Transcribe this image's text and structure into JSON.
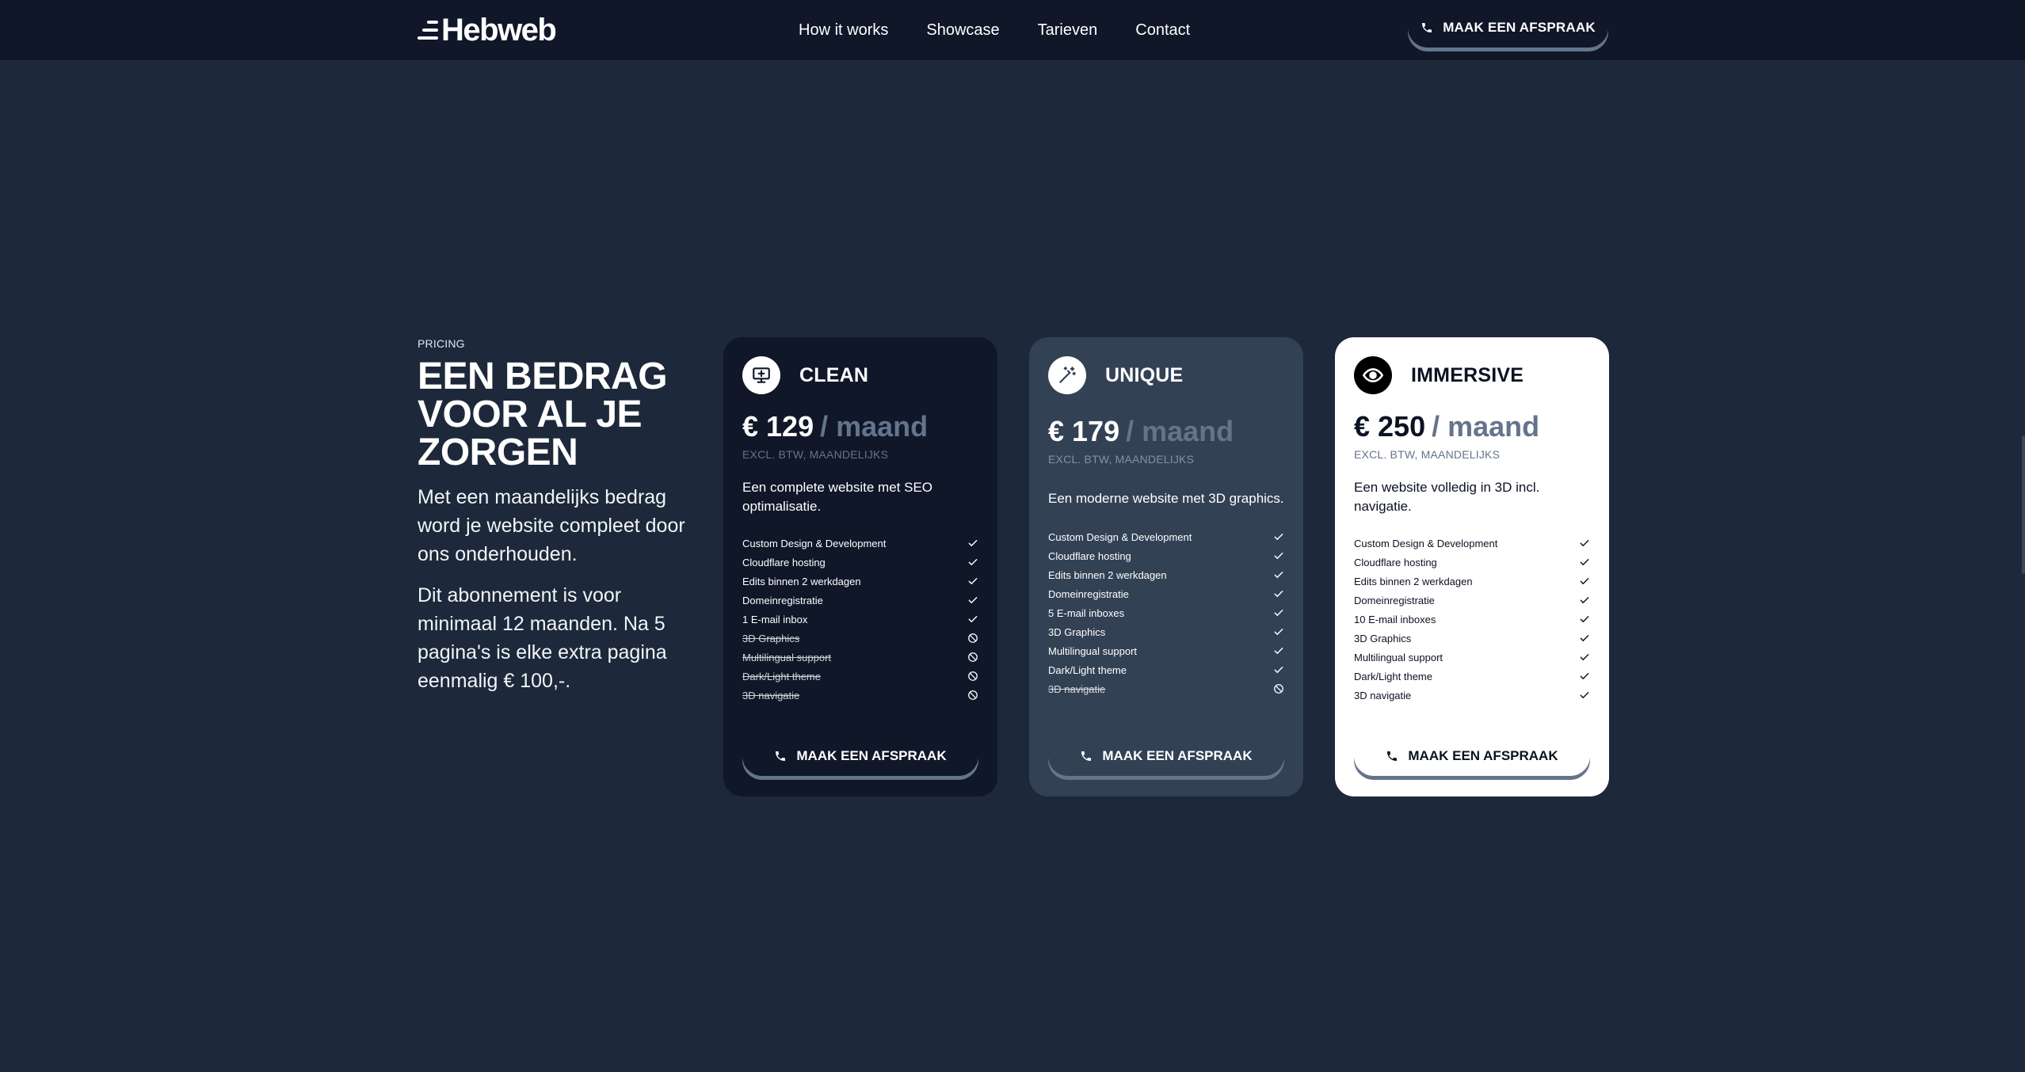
{
  "brand": {
    "name": "Hebweb"
  },
  "nav": {
    "links": [
      "How it works",
      "Showcase",
      "Tarieven",
      "Contact"
    ],
    "cta_label": "MAAK EEN AFSPRAAK"
  },
  "intro": {
    "eyebrow": "PRICING",
    "headline": "EEN BEDRAG VOOR AL JE ZORGEN",
    "paragraphs": [
      "Met een maandelijks bedrag word je website compleet door ons onderhouden.",
      "Dit abonnement is voor minimaal 12 maanden. Na 5 pagina's is elke extra pagina eenmalig € 100,-."
    ]
  },
  "plans": [
    {
      "name": "CLEAN",
      "icon": "monitor-icon",
      "price": "€ 129",
      "period": "/ maand",
      "note": "EXCL. BTW, MAANDELIJKS",
      "description": "Een complete website met SEO optimalisatie.",
      "features": [
        {
          "label": "Custom Design & Development",
          "included": true
        },
        {
          "label": "Cloudflare hosting",
          "included": true
        },
        {
          "label": "Edits binnen 2 werkdagen",
          "included": true
        },
        {
          "label": "Domeinregistratie",
          "included": true
        },
        {
          "label": "1 E-mail inbox",
          "included": true
        },
        {
          "label": "3D Graphics",
          "included": false
        },
        {
          "label": "Multilingual support",
          "included": false
        },
        {
          "label": "Dark/Light theme",
          "included": false
        },
        {
          "label": "3D navigatie",
          "included": false
        }
      ],
      "cta_label": "MAAK EEN AFSPRAAK"
    },
    {
      "name": "UNIQUE",
      "icon": "magic-wand-icon",
      "price": "€ 179",
      "period": "/ maand",
      "note": "EXCL. BTW, MAANDELIJKS",
      "description": "Een moderne website met 3D graphics.",
      "features": [
        {
          "label": "Custom Design & Development",
          "included": true
        },
        {
          "label": "Cloudflare hosting",
          "included": true
        },
        {
          "label": "Edits binnen 2 werkdagen",
          "included": true
        },
        {
          "label": "Domeinregistratie",
          "included": true
        },
        {
          "label": "5 E-mail inboxes",
          "included": true
        },
        {
          "label": "3D Graphics",
          "included": true
        },
        {
          "label": "Multilingual support",
          "included": true
        },
        {
          "label": "Dark/Light theme",
          "included": true
        },
        {
          "label": "3D navigatie",
          "included": false
        }
      ],
      "cta_label": "MAAK EEN AFSPRAAK"
    },
    {
      "name": "IMMERSIVE",
      "icon": "eye-icon",
      "price": "€ 250",
      "period": "/ maand",
      "note": "EXCL. BTW, MAANDELIJKS",
      "description": "Een website volledig in 3D incl. navigatie.",
      "features": [
        {
          "label": "Custom Design & Development",
          "included": true
        },
        {
          "label": "Cloudflare hosting",
          "included": true
        },
        {
          "label": "Edits binnen 2 werkdagen",
          "included": true
        },
        {
          "label": "Domeinregistratie",
          "included": true
        },
        {
          "label": "10 E-mail inboxes",
          "included": true
        },
        {
          "label": "3D Graphics",
          "included": true
        },
        {
          "label": "Multilingual support",
          "included": true
        },
        {
          "label": "Dark/Light theme",
          "included": true
        },
        {
          "label": "3D navigatie",
          "included": true
        }
      ],
      "cta_label": "MAAK EEN AFSPRAAK"
    }
  ],
  "colors": {
    "page_bg": "#1d283a",
    "nav_bg": "#0f1729",
    "card_clean_bg": "#0f1729",
    "card_unique_bg": "#334155",
    "card_immersive_bg": "#ffffff",
    "muted": "#64748b"
  }
}
